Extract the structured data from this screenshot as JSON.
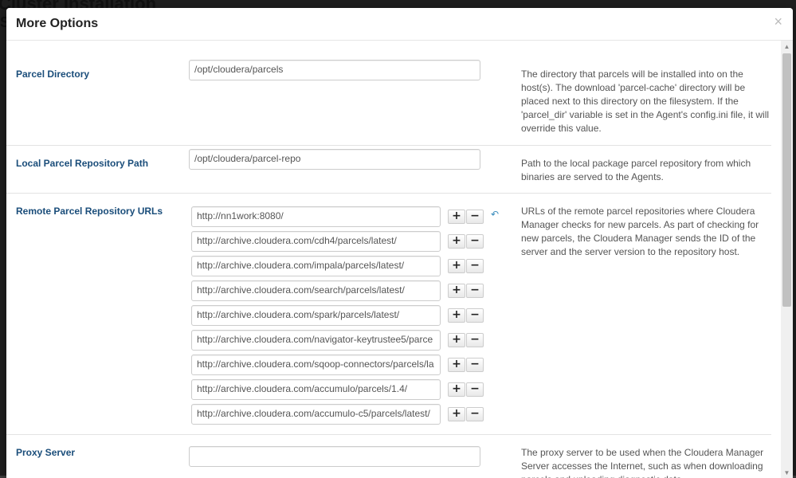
{
  "background": {
    "page_title": "Cluster Installation",
    "cut_letter": "S"
  },
  "modal": {
    "title": "More Options",
    "close_symbol": "×"
  },
  "settings": {
    "parcel_directory": {
      "label": "Parcel Directory",
      "value": "/opt/cloudera/parcels",
      "help": "The directory that parcels will be installed into on the host(s). The download 'parcel-cache' directory will be placed next to this directory on the filesystem. If the 'parcel_dir' variable is set in the Agent's config.ini file, it will override this value."
    },
    "local_repo_path": {
      "label": "Local Parcel Repository Path",
      "value": "/opt/cloudera/parcel-repo",
      "help": "Path to the local package parcel repository from which binaries are served to the Agents."
    },
    "remote_repo_urls": {
      "label": "Remote Parcel Repository URLs",
      "help": "URLs of the remote parcel repositories where Cloudera Manager checks for new parcels. As part of checking for new parcels, the Cloudera Manager sends the ID of the server and the server version to the repository host.",
      "plus": "+",
      "minus": "−",
      "undo": "↶",
      "urls": [
        "http://nn1work:8080/",
        "http://archive.cloudera.com/cdh4/parcels/latest/",
        "http://archive.cloudera.com/impala/parcels/latest/",
        "http://archive.cloudera.com/search/parcels/latest/",
        "http://archive.cloudera.com/spark/parcels/latest/",
        "http://archive.cloudera.com/navigator-keytrustee5/parce",
        "http://archive.cloudera.com/sqoop-connectors/parcels/la",
        "http://archive.cloudera.com/accumulo/parcels/1.4/",
        "http://archive.cloudera.com/accumulo-c5/parcels/latest/"
      ]
    },
    "proxy_server": {
      "label": "Proxy Server",
      "value": "",
      "help": "The proxy server to be used when the Cloudera Manager Server accesses the Internet, such as when downloading parcels and uploading diagnostic data."
    }
  },
  "scrollbar": {
    "up": "▲",
    "down": "▼"
  }
}
